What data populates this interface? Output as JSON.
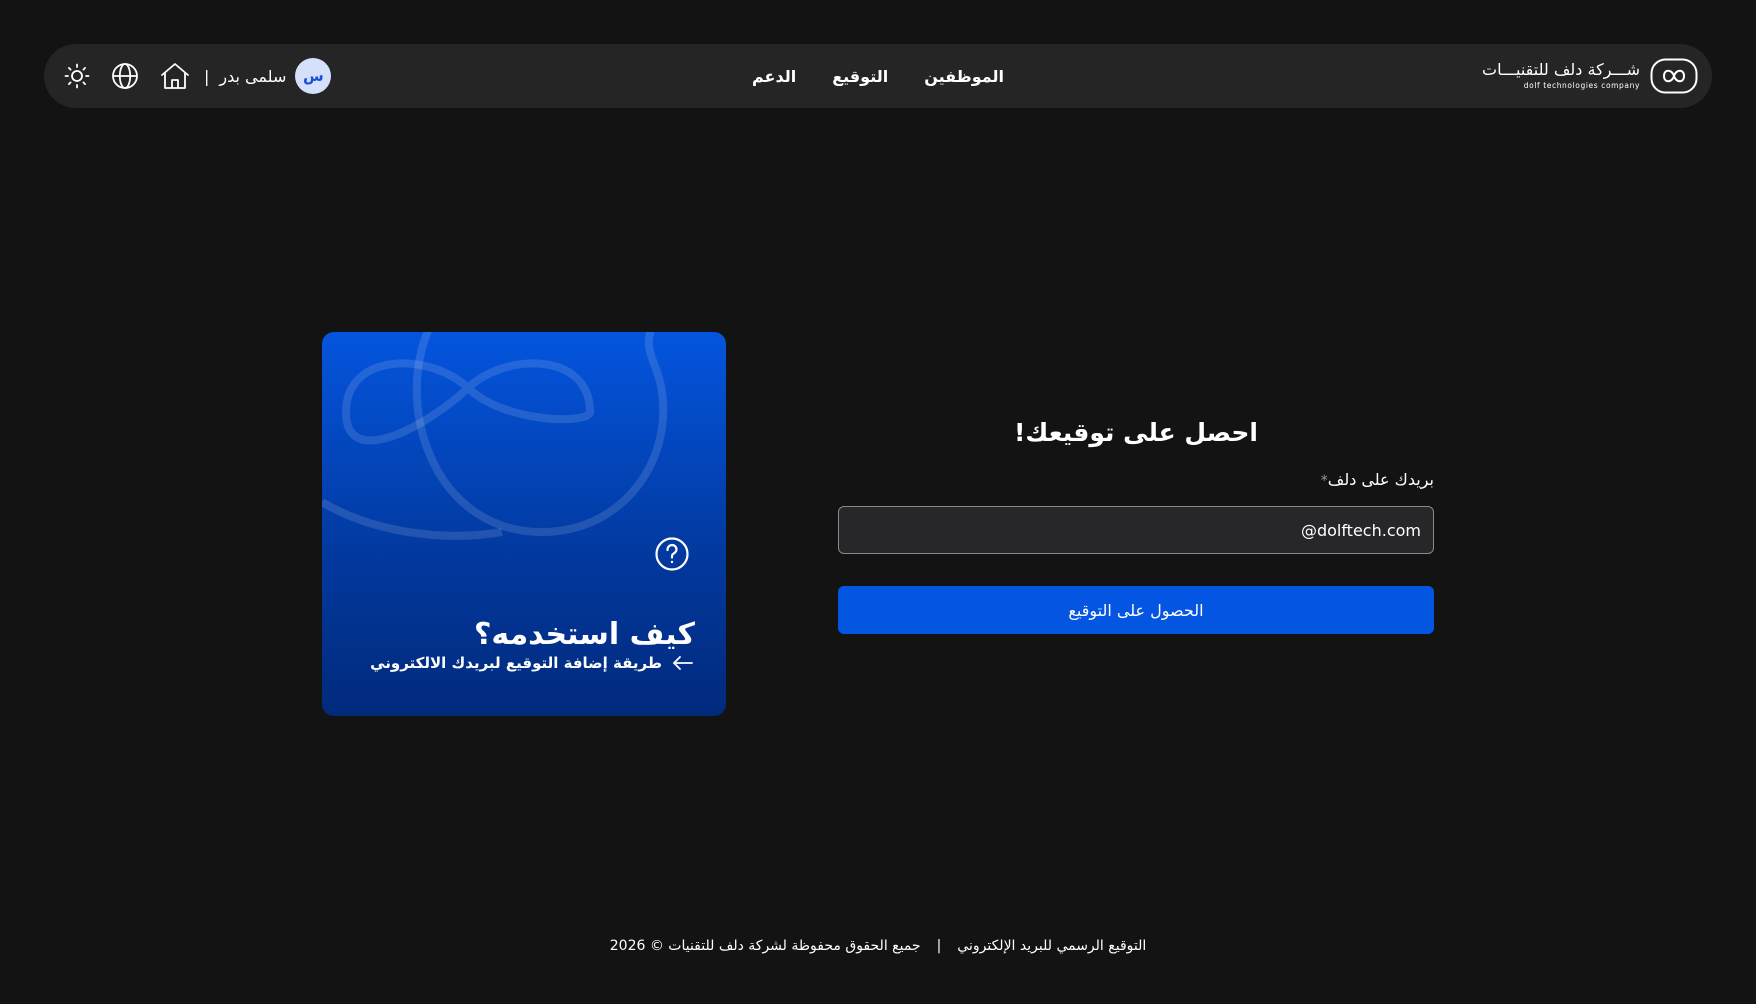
{
  "header": {
    "brand": {
      "name_ar": "شـــركة دلف للتقنيـــات",
      "name_en": "dolf technologies company"
    },
    "nav": [
      {
        "label": "الموظفين"
      },
      {
        "label": "التوقيع"
      },
      {
        "label": "الدعم"
      }
    ],
    "user": {
      "avatar_initial": "س",
      "name": "سلمى بدر",
      "separator": "|"
    },
    "icons": [
      "home-icon",
      "globe-icon",
      "sun-icon"
    ]
  },
  "card": {
    "icon": "help-icon",
    "title": "كيف استخدمه؟",
    "link_label": "طريقة إضافة التوقيع لبريدك الالكتروني",
    "link_icon": "arrow-left-icon"
  },
  "form": {
    "title": "احصل على توقيعك!",
    "email_label": "بريدك على دلف",
    "required_mark": "*",
    "email_value": "@dolftech.com",
    "submit_label": "الحصول على التوقيع"
  },
  "footer": {
    "left_text": "التوقيع الرسمي للبريد الإلكتروني",
    "separator": "|",
    "right_text": "جميع الحقوق محفوظة لشركة دلف للتقنيات © 2026"
  },
  "colors": {
    "background": "#131314",
    "header_bg": "#252526",
    "accent": "#0455e1",
    "card_top": "#0455de",
    "card_bottom": "#012a7c",
    "input_bg": "#27272a",
    "avatar_bg": "#d5e1fb",
    "avatar_text": "#1a4fd8"
  }
}
